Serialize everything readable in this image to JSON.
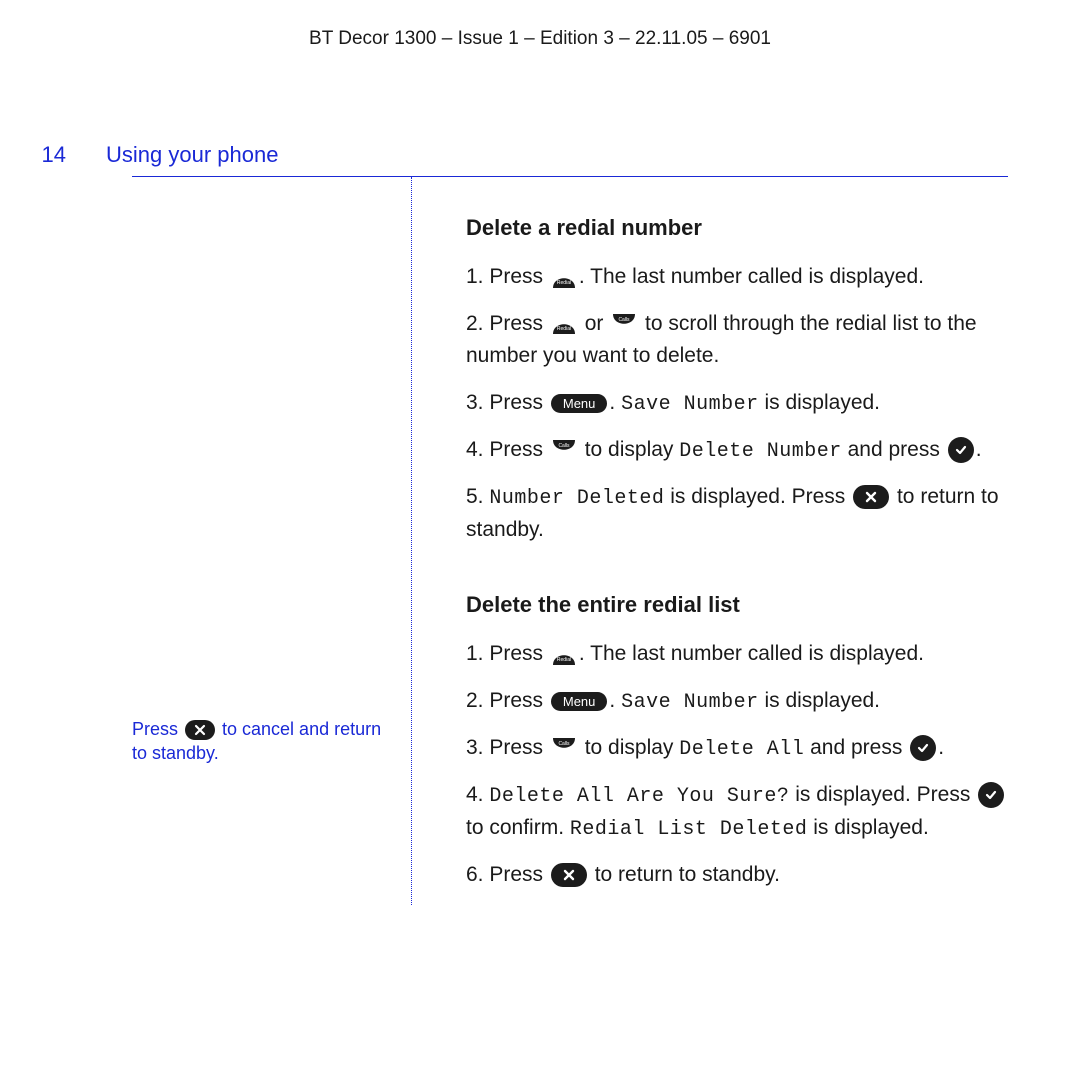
{
  "header": "BT Decor 1300 – Issue 1 – Edition 3 – 22.11.05 – 6901",
  "page_number": "14",
  "section_title": "Using your phone",
  "sidebar": {
    "prefix": "Press ",
    "suffix": " to cancel and return to standby."
  },
  "sec1": {
    "title": "Delete a redial number",
    "step1_a": "1. Press ",
    "step1_b": ". The last number called is displayed.",
    "step2_a": "2.  Press ",
    "step2_or": " or ",
    "step2_b": " to scroll through the redial list to the number you want to delete.",
    "step3_a": "3. Press ",
    "step3_b": ". ",
    "step3_lcd": "Save Number",
    "step3_c": " is displayed.",
    "step4_a": "4. Press ",
    "step4_b": " to display ",
    "step4_lcd": "Delete Number",
    "step4_c": " and press ",
    "step4_d": ".",
    "step5_a": "5. ",
    "step5_lcd": "Number Deleted",
    "step5_b": " is displayed. Press ",
    "step5_c": " to return to standby."
  },
  "sec2": {
    "title": "Delete the entire redial list",
    "step1_a": "1. Press ",
    "step1_b": ". The last number called is displayed.",
    "step2_a": "2. Press ",
    "step2_b": ". ",
    "step2_lcd": "Save Number",
    "step2_c": " is displayed.",
    "step3_a": "3. Press ",
    "step3_b": " to display ",
    "step3_lcd": "Delete All",
    "step3_c": " and press ",
    "step3_d": ".",
    "step4_a": "4. ",
    "step4_lcd1": "Delete All Are You Sure?",
    "step4_b": " is displayed. Press ",
    "step4_c": " to confirm. ",
    "step4_lcd2": "Redial List Deleted",
    "step4_d": " is displayed.",
    "step6_a": "6.  Press ",
    "step6_b": " to return to standby."
  },
  "icons": {
    "menu_label": "Menu"
  }
}
